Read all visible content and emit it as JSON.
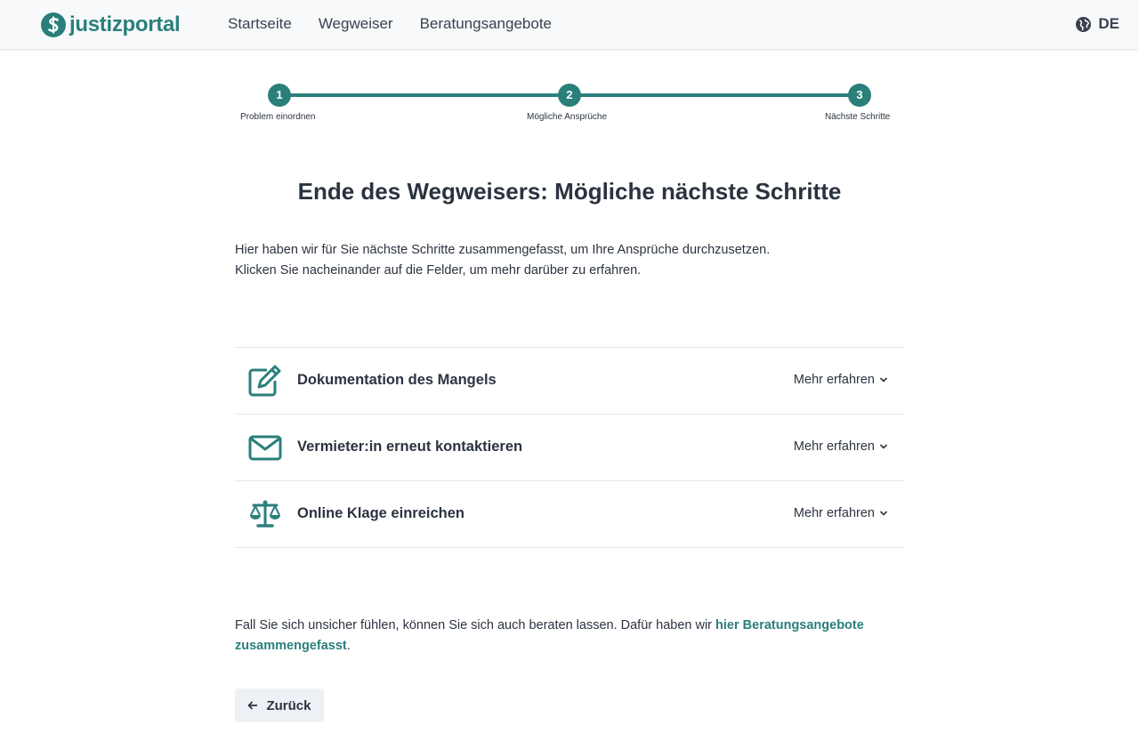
{
  "colors": {
    "accent": "#2a7f7b",
    "text": "#2b3340",
    "header_bg": "#f7f9fb",
    "button_bg": "#edf0f4"
  },
  "header": {
    "logo_text": "justizportal",
    "nav": [
      "Startseite",
      "Wegweiser",
      "Beratungsangebote"
    ],
    "language": "DE"
  },
  "stepper": {
    "steps": [
      {
        "number": "1",
        "label": "Problem einordnen"
      },
      {
        "number": "2",
        "label": "Mögliche Ansprüche"
      },
      {
        "number": "3",
        "label": "Nächste Schritte"
      }
    ],
    "current_step": 3
  },
  "main": {
    "title": "Ende des Wegweisers: Mögliche nächste Schritte",
    "intro_line1": "Hier haben wir für Sie nächste Schritte zusammengefasst, um Ihre Ansprüche durchzusetzen.",
    "intro_line2": "Klicken Sie nacheinander auf die Felder, um mehr darüber zu erfahren.",
    "items": [
      {
        "icon": "edit-icon",
        "title": "Dokumentation des Mangels",
        "more": "Mehr erfahren"
      },
      {
        "icon": "mail-icon",
        "title": "Vermieter:in erneut kontaktieren",
        "more": "Mehr erfahren"
      },
      {
        "icon": "scale-icon",
        "title": "Online Klage einreichen",
        "more": "Mehr erfahren"
      }
    ],
    "advice_text": "Fall Sie sich unsicher fühlen, können Sie sich auch beraten lassen. Dafür haben wir ",
    "advice_link": "hier Beratungsangebote zusammengefasst",
    "advice_end": ".",
    "back_label": "Zurück"
  }
}
